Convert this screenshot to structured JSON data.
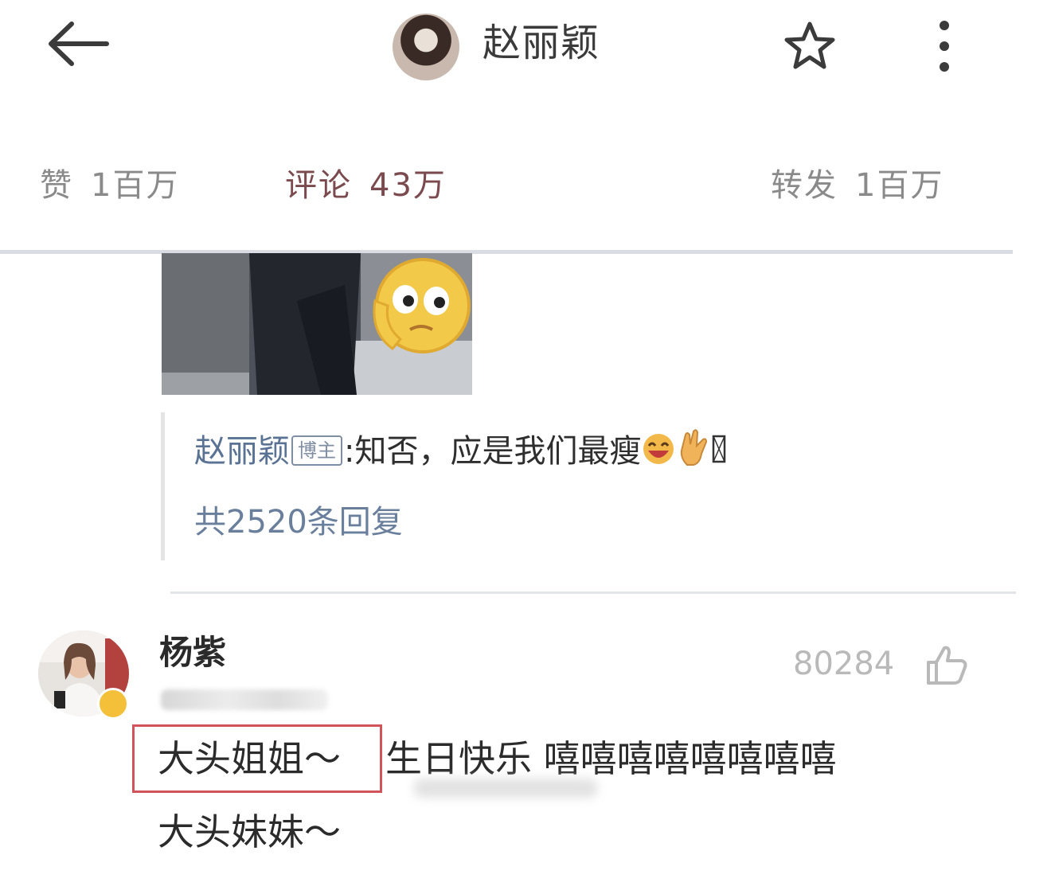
{
  "header": {
    "title": "赵丽颖"
  },
  "stats": {
    "likes_label": "赞",
    "likes_count": "1百万",
    "comments_label": "评论",
    "comments_count": "43万",
    "reposts_label": "转发",
    "reposts_count": "1百万"
  },
  "reply": {
    "author": "赵丽颖",
    "badge": "博主",
    "text": ":知否，应是我们最瘦",
    "count": "共2520条回复"
  },
  "comment": {
    "author": "杨紫",
    "like_count": "80284",
    "highlight_text": "大头姐姐～",
    "line1_text": "生日快乐 嘻嘻嘻嘻嘻嘻嘻嘻",
    "line2_text": "大头妹妹～"
  },
  "colors": {
    "accent": "#d0545a",
    "link": "#5a7394",
    "muted": "#8a8a8a"
  }
}
